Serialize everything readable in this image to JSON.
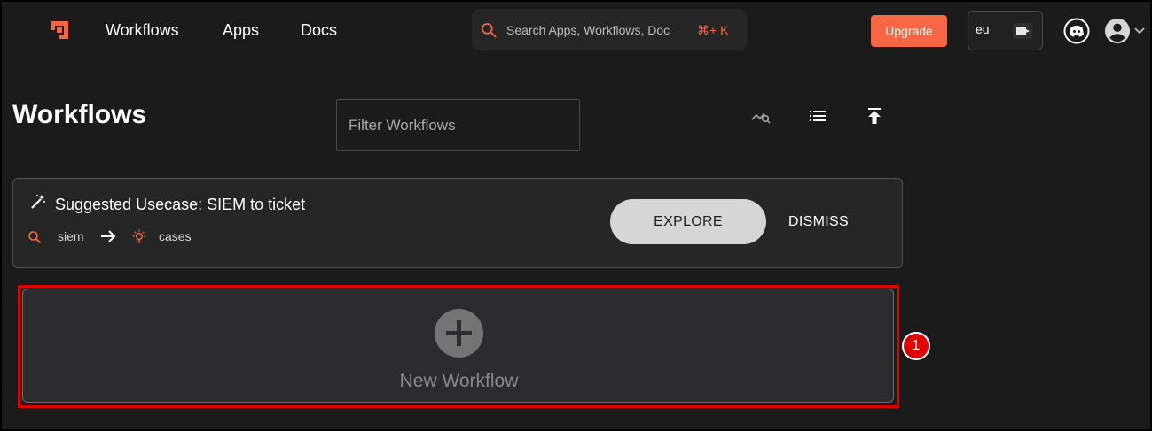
{
  "header": {
    "logo_icon": "shuffle-logo-icon",
    "nav": [
      "Workflows",
      "Apps",
      "Docs"
    ],
    "search": {
      "placeholder": "Search Apps, Workflows, Doc",
      "shortcut": "⌘+ K"
    },
    "upgrade_label": "Upgrade",
    "region": {
      "label": "eu"
    },
    "icons": {
      "discord": "discord-icon",
      "account": "account-circle-icon"
    }
  },
  "page": {
    "title": "Workflows",
    "filter_placeholder": "Filter Workflows",
    "toolbar_icons": [
      "search-insights-icon",
      "list-view-icon",
      "upload-icon"
    ]
  },
  "usecase": {
    "title": "Suggested Usecase: SIEM to ticket",
    "from": "siem",
    "to": "cases",
    "explore_label": "EXPLORE",
    "dismiss_label": "DISMISS"
  },
  "new_workflow": {
    "label": "New Workflow"
  },
  "annotation": {
    "badge": "1",
    "color": "#e00000"
  },
  "colors": {
    "accent": "#f86743",
    "background": "#1b1b1b"
  }
}
